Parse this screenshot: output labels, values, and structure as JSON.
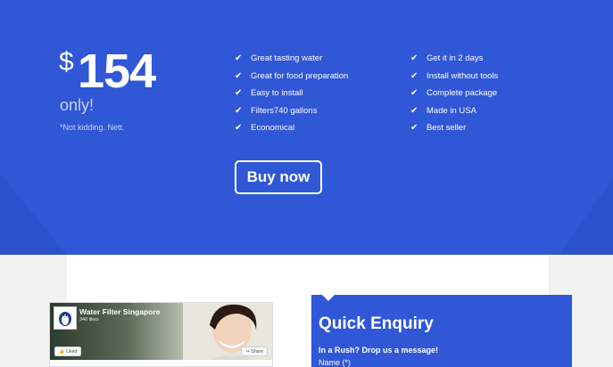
{
  "pricing": {
    "currency": "$",
    "amount": "154",
    "suffix": "only!",
    "note": "*Not kidding. Nett."
  },
  "features": {
    "col1": [
      "Great tasting water",
      "Great for food preparation",
      "Easy to install",
      "Filters740 gallons",
      "Economical"
    ],
    "col2": [
      "Get it in 2 days",
      "Install without tools",
      "Complete package",
      "Made in USA",
      "Best seller"
    ]
  },
  "cta": {
    "label": "Buy now"
  },
  "facebook": {
    "page_name": "Water Filter Singapore",
    "likes": "340 likes",
    "like_label": "Liked",
    "share_label": "Share"
  },
  "enquiry": {
    "title": "Quick Enquiry",
    "subtitle": "In a Rush? Drop us a message!",
    "name_label": "Name (*)"
  },
  "colors": {
    "brand_blue": "#2f57d6",
    "text_light": "#ffffff",
    "muted": "#c9d4f5",
    "page_bg": "#f2f2f2"
  },
  "icons": {
    "feature": "checkmark-icon",
    "like": "thumbs-up-icon",
    "share": "share-arrow-icon",
    "avatar": "penguin-logo-icon"
  }
}
